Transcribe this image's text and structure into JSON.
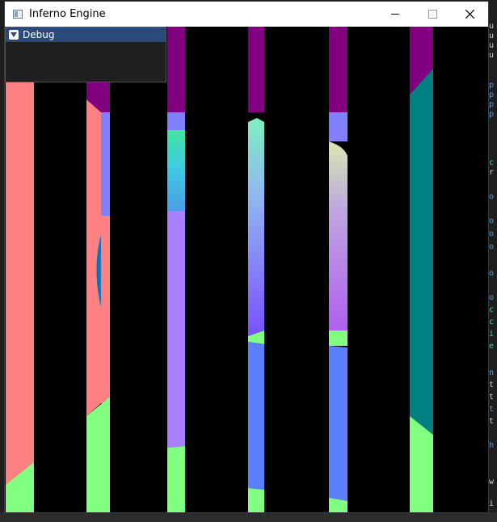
{
  "window": {
    "title": "Inferno Engine",
    "titlebar_color": "#ffffff",
    "viewport_color": "#000000"
  },
  "debug_panel": {
    "title": "Debug",
    "header_color": "#294a7a"
  },
  "icons": {
    "app": "app-window-icon",
    "minimize": "minimize-icon",
    "maximize": "maximize-icon",
    "close": "close-icon",
    "collapse": "triangle-down-icon"
  },
  "colors": {
    "salmon": "#ff8080",
    "green": "#80ff80",
    "purple": "#800080",
    "teal": "#008080",
    "lavender": "#a880ff",
    "blue": "#5c7fff"
  },
  "background_editor": {
    "fragments": [
      "u",
      "u",
      "u",
      "u",
      "p",
      "p",
      "p",
      "p",
      "c",
      "r",
      "o",
      "o",
      "o",
      "o",
      "o",
      "o",
      "c",
      "c",
      "i",
      "e",
      "n",
      "t",
      "t",
      "t",
      "t",
      "h",
      "w",
      "i"
    ]
  }
}
